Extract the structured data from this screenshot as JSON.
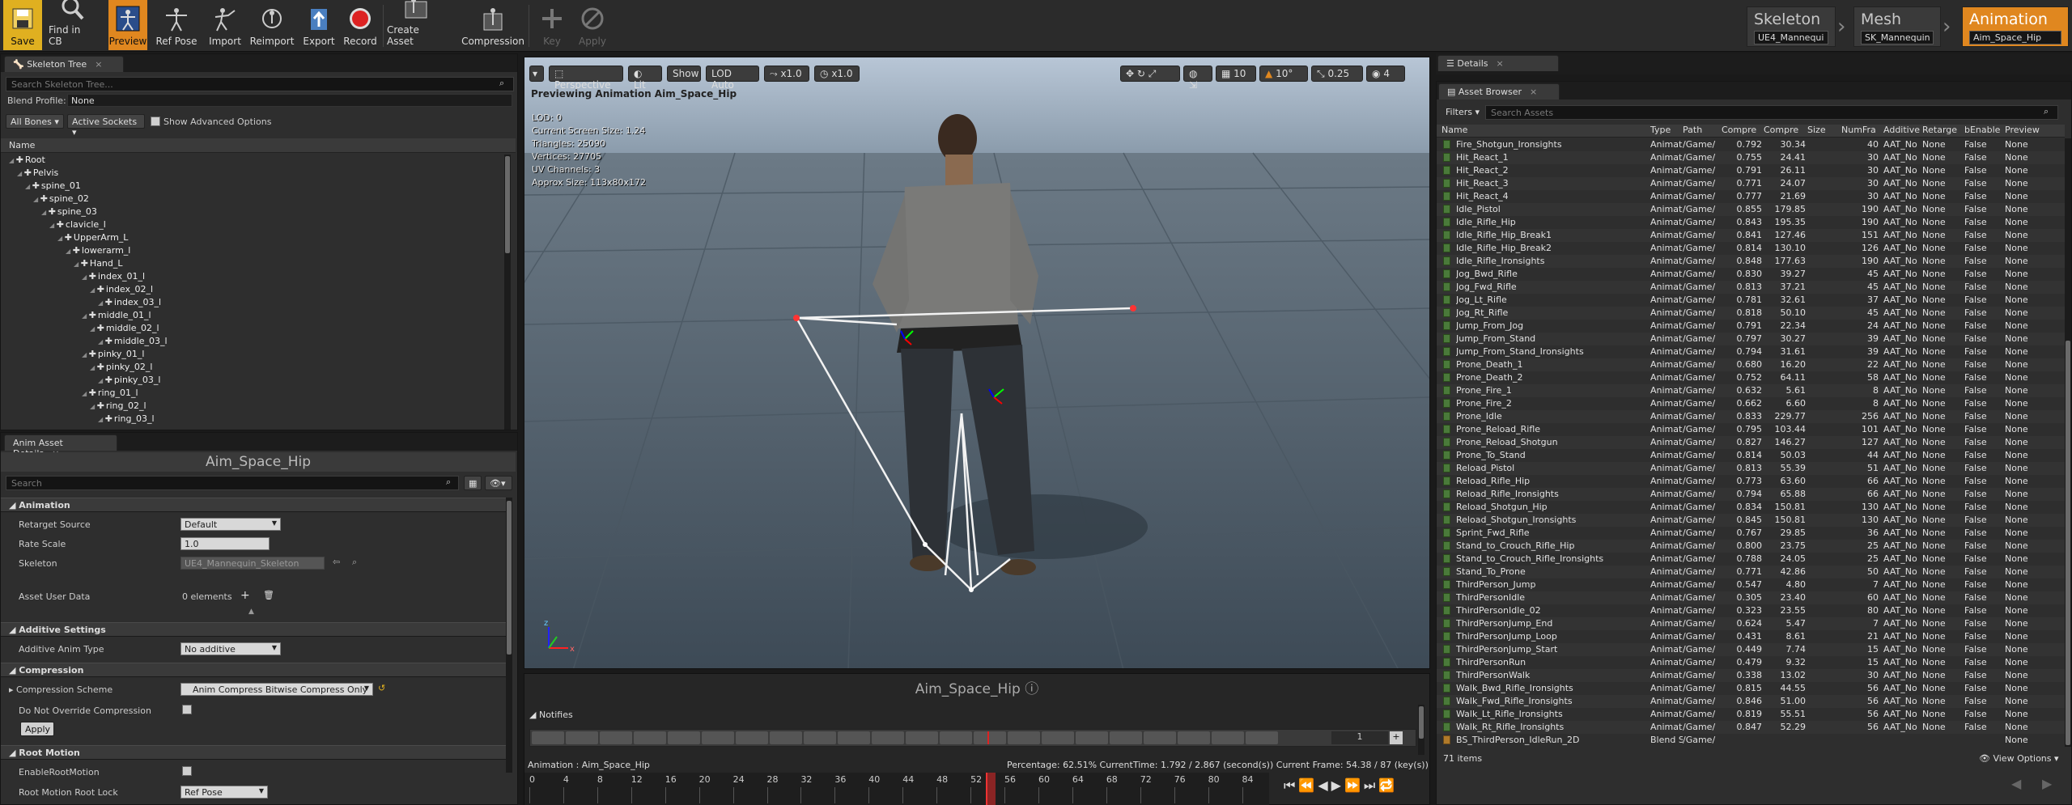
{
  "toolbar": {
    "buttons": [
      {
        "label": "Save",
        "icon": "save-icon"
      },
      {
        "label": "Find in CB",
        "icon": "find-in-cb-icon"
      },
      {
        "label": "Preview",
        "icon": "preview-icon"
      },
      {
        "label": "Ref Pose",
        "icon": "ref-pose-icon"
      },
      {
        "label": "Import",
        "icon": "import-icon"
      },
      {
        "label": "Reimport",
        "icon": "reimport-icon"
      },
      {
        "label": "Export",
        "icon": "export-icon"
      },
      {
        "label": "Record",
        "icon": "record-icon"
      },
      {
        "label": "Create Asset",
        "icon": "create-asset-icon"
      },
      {
        "label": "Compression",
        "icon": "compression-icon"
      },
      {
        "label": "Key",
        "icon": "key-icon"
      },
      {
        "label": "Apply",
        "icon": "apply-icon"
      }
    ]
  },
  "modes": {
    "skeleton": {
      "title": "Skeleton",
      "asset": "UE4_Mannequi"
    },
    "mesh": {
      "title": "Mesh",
      "asset": "SK_Mannequin"
    },
    "animation": {
      "title": "Animation",
      "asset": "Aim_Space_Hip"
    }
  },
  "skeleton_tree": {
    "tab": "Skeleton Tree",
    "search_placeholder": "Search Skeleton Tree...",
    "blend_profile_label": "Blend Profile:",
    "blend_profile_value": "None",
    "all_bones": "All Bones",
    "active_sockets": "Active Sockets",
    "show_advanced": "Show Advanced Options",
    "column": "Name",
    "bones": [
      {
        "name": "Root",
        "depth": 0
      },
      {
        "name": "Pelvis",
        "depth": 1
      },
      {
        "name": "spine_01",
        "depth": 2
      },
      {
        "name": "spine_02",
        "depth": 3
      },
      {
        "name": "spine_03",
        "depth": 4
      },
      {
        "name": "clavicle_l",
        "depth": 5
      },
      {
        "name": "UpperArm_L",
        "depth": 6
      },
      {
        "name": "lowerarm_l",
        "depth": 7
      },
      {
        "name": "Hand_L",
        "depth": 8
      },
      {
        "name": "index_01_l",
        "depth": 9
      },
      {
        "name": "index_02_l",
        "depth": 10
      },
      {
        "name": "index_03_l",
        "depth": 11
      },
      {
        "name": "middle_01_l",
        "depth": 9
      },
      {
        "name": "middle_02_l",
        "depth": 10
      },
      {
        "name": "middle_03_l",
        "depth": 11
      },
      {
        "name": "pinky_01_l",
        "depth": 9
      },
      {
        "name": "pinky_02_l",
        "depth": 10
      },
      {
        "name": "pinky_03_l",
        "depth": 11
      },
      {
        "name": "ring_01_l",
        "depth": 9
      },
      {
        "name": "ring_02_l",
        "depth": 10
      },
      {
        "name": "ring_03_l",
        "depth": 11
      }
    ]
  },
  "anim_details": {
    "tab": "Anim Asset Details",
    "title": "Aim_Space_Hip",
    "search_placeholder": "Search",
    "sections": {
      "animation": "Animation",
      "additive": "Additive Settings",
      "compression": "Compression",
      "root_motion": "Root Motion"
    },
    "retarget_source_label": "Retarget Source",
    "retarget_source_value": "Default",
    "rate_scale_label": "Rate Scale",
    "rate_scale_value": "1.0",
    "skeleton_label": "Skeleton",
    "skeleton_value": "UE4_Mannequin_Skeleton",
    "asset_user_data_label": "Asset User Data",
    "asset_user_data_value": "0 elements",
    "additive_type_label": "Additive Anim Type",
    "additive_type_value": "No additive",
    "compression_scheme_label": "Compression Scheme",
    "compression_scheme_value": "Anim Compress Bitwise Compress Only",
    "no_override_label": "Do Not Override Compression",
    "apply_label": "Apply",
    "enable_root_motion_label": "EnableRootMotion",
    "root_lock_label": "Root Motion Root Lock",
    "root_lock_value": "Ref Pose"
  },
  "viewport": {
    "perspective": "Perspective",
    "lit": "Lit",
    "show": "Show",
    "lod": "LOD Auto",
    "speed1": "x1.0",
    "speed2": "x1.0",
    "grid": "10",
    "rot": "10°",
    "scale": "0.25",
    "cam": "4",
    "preview_text": "Previewing Animation Aim_Space_Hip",
    "stats": [
      "LOD: 0",
      "Current Screen Size: 1.24",
      "Triangles: 25090",
      "Vertices: 27705",
      "UV Channels: 3",
      "Approx Size: 113x80x172"
    ]
  },
  "timeline": {
    "title": "Aim_Space_Hip",
    "notifies": "Notifies",
    "track_number": "1",
    "animation_label": "Animation :  Aim_Space_Hip",
    "status": "Percentage:  62.51%  CurrentTime:  1.792 / 2.867 (second(s))  Current Frame:  54.38 / 87 (key(s))",
    "ticks": [
      "0",
      "4",
      "8",
      "12",
      "16",
      "20",
      "24",
      "28",
      "32",
      "36",
      "40",
      "44",
      "48",
      "52",
      "56",
      "60",
      "64",
      "68",
      "72",
      "76",
      "80",
      "84"
    ],
    "playhead_frame": 54.38,
    "total_frames": 87
  },
  "details_tab": "Details",
  "asset_browser": {
    "tab": "Asset Browser",
    "filters": "Filters",
    "search_placeholder": "Search Assets",
    "columns": [
      "Name",
      "Type",
      "Path",
      "Compre",
      "Compre",
      "Size",
      "NumFra",
      "Additive",
      "Retarge",
      "bEnable",
      "Preview"
    ],
    "rows": [
      [
        "Fire_Shotgun_Ironsights",
        "Animat",
        "/Game/",
        "0.792",
        "30.34",
        "",
        "40",
        "AAT_No",
        "None",
        "False",
        "None"
      ],
      [
        "Hit_React_1",
        "Animat",
        "/Game/",
        "0.755",
        "24.41",
        "",
        "30",
        "AAT_No",
        "None",
        "False",
        "None"
      ],
      [
        "Hit_React_2",
        "Animat",
        "/Game/",
        "0.791",
        "26.11",
        "",
        "30",
        "AAT_No",
        "None",
        "False",
        "None"
      ],
      [
        "Hit_React_3",
        "Animat",
        "/Game/",
        "0.771",
        "24.07",
        "",
        "30",
        "AAT_No",
        "None",
        "False",
        "None"
      ],
      [
        "Hit_React_4",
        "Animat",
        "/Game/",
        "0.777",
        "21.69",
        "",
        "30",
        "AAT_No",
        "None",
        "False",
        "None"
      ],
      [
        "Idle_Pistol",
        "Animat",
        "/Game/",
        "0.855",
        "179.85",
        "",
        "190",
        "AAT_No",
        "None",
        "False",
        "None"
      ],
      [
        "Idle_Rifle_Hip",
        "Animat",
        "/Game/",
        "0.843",
        "195.35",
        "",
        "190",
        "AAT_No",
        "None",
        "False",
        "None"
      ],
      [
        "Idle_Rifle_Hip_Break1",
        "Animat",
        "/Game/",
        "0.841",
        "127.46",
        "",
        "151",
        "AAT_No",
        "None",
        "False",
        "None"
      ],
      [
        "Idle_Rifle_Hip_Break2",
        "Animat",
        "/Game/",
        "0.814",
        "130.10",
        "",
        "126",
        "AAT_No",
        "None",
        "False",
        "None"
      ],
      [
        "Idle_Rifle_Ironsights",
        "Animat",
        "/Game/",
        "0.848",
        "177.63",
        "",
        "190",
        "AAT_No",
        "None",
        "False",
        "None"
      ],
      [
        "Jog_Bwd_Rifle",
        "Animat",
        "/Game/",
        "0.830",
        "39.27",
        "",
        "45",
        "AAT_No",
        "None",
        "False",
        "None"
      ],
      [
        "Jog_Fwd_Rifle",
        "Animat",
        "/Game/",
        "0.813",
        "37.21",
        "",
        "45",
        "AAT_No",
        "None",
        "False",
        "None"
      ],
      [
        "Jog_Lt_Rifle",
        "Animat",
        "/Game/",
        "0.781",
        "32.61",
        "",
        "37",
        "AAT_No",
        "None",
        "False",
        "None"
      ],
      [
        "Jog_Rt_Rifle",
        "Animat",
        "/Game/",
        "0.818",
        "50.10",
        "",
        "45",
        "AAT_No",
        "None",
        "False",
        "None"
      ],
      [
        "Jump_From_Jog",
        "Animat",
        "/Game/",
        "0.791",
        "22.34",
        "",
        "24",
        "AAT_No",
        "None",
        "False",
        "None"
      ],
      [
        "Jump_From_Stand",
        "Animat",
        "/Game/",
        "0.797",
        "30.27",
        "",
        "39",
        "AAT_No",
        "None",
        "False",
        "None"
      ],
      [
        "Jump_From_Stand_Ironsights",
        "Animat",
        "/Game/",
        "0.794",
        "31.61",
        "",
        "39",
        "AAT_No",
        "None",
        "False",
        "None"
      ],
      [
        "Prone_Death_1",
        "Animat",
        "/Game/",
        "0.680",
        "16.20",
        "",
        "22",
        "AAT_No",
        "None",
        "False",
        "None"
      ],
      [
        "Prone_Death_2",
        "Animat",
        "/Game/",
        "0.752",
        "64.11",
        "",
        "58",
        "AAT_No",
        "None",
        "False",
        "None"
      ],
      [
        "Prone_Fire_1",
        "Animat",
        "/Game/",
        "0.632",
        "5.61",
        "",
        "8",
        "AAT_No",
        "None",
        "False",
        "None"
      ],
      [
        "Prone_Fire_2",
        "Animat",
        "/Game/",
        "0.662",
        "6.60",
        "",
        "8",
        "AAT_No",
        "None",
        "False",
        "None"
      ],
      [
        "Prone_Idle",
        "Animat",
        "/Game/",
        "0.833",
        "229.77",
        "",
        "256",
        "AAT_No",
        "None",
        "False",
        "None"
      ],
      [
        "Prone_Reload_Rifle",
        "Animat",
        "/Game/",
        "0.795",
        "103.44",
        "",
        "101",
        "AAT_No",
        "None",
        "False",
        "None"
      ],
      [
        "Prone_Reload_Shotgun",
        "Animat",
        "/Game/",
        "0.827",
        "146.27",
        "",
        "127",
        "AAT_No",
        "None",
        "False",
        "None"
      ],
      [
        "Prone_To_Stand",
        "Animat",
        "/Game/",
        "0.814",
        "50.03",
        "",
        "44",
        "AAT_No",
        "None",
        "False",
        "None"
      ],
      [
        "Reload_Pistol",
        "Animat",
        "/Game/",
        "0.813",
        "55.39",
        "",
        "51",
        "AAT_No",
        "None",
        "False",
        "None"
      ],
      [
        "Reload_Rifle_Hip",
        "Animat",
        "/Game/",
        "0.773",
        "63.60",
        "",
        "66",
        "AAT_No",
        "None",
        "False",
        "None"
      ],
      [
        "Reload_Rifle_Ironsights",
        "Animat",
        "/Game/",
        "0.794",
        "65.88",
        "",
        "66",
        "AAT_No",
        "None",
        "False",
        "None"
      ],
      [
        "Reload_Shotgun_Hip",
        "Animat",
        "/Game/",
        "0.834",
        "150.81",
        "",
        "130",
        "AAT_No",
        "None",
        "False",
        "None"
      ],
      [
        "Reload_Shotgun_Ironsights",
        "Animat",
        "/Game/",
        "0.845",
        "150.81",
        "",
        "130",
        "AAT_No",
        "None",
        "False",
        "None"
      ],
      [
        "Sprint_Fwd_Rifle",
        "Animat",
        "/Game/",
        "0.767",
        "29.85",
        "",
        "36",
        "AAT_No",
        "None",
        "False",
        "None"
      ],
      [
        "Stand_to_Crouch_Rifle_Hip",
        "Animat",
        "/Game/",
        "0.800",
        "23.75",
        "",
        "25",
        "AAT_No",
        "None",
        "False",
        "None"
      ],
      [
        "Stand_to_Crouch_Rifle_Ironsights",
        "Animat",
        "/Game/",
        "0.788",
        "24.05",
        "",
        "25",
        "AAT_No",
        "None",
        "False",
        "None"
      ],
      [
        "Stand_To_Prone",
        "Animat",
        "/Game/",
        "0.771",
        "42.86",
        "",
        "50",
        "AAT_No",
        "None",
        "False",
        "None"
      ],
      [
        "ThirdPerson_Jump",
        "Animat",
        "/Game/",
        "0.547",
        "4.80",
        "",
        "7",
        "AAT_No",
        "None",
        "False",
        "None"
      ],
      [
        "ThirdPersonIdle",
        "Animat",
        "/Game/",
        "0.305",
        "23.40",
        "",
        "60",
        "AAT_No",
        "None",
        "False",
        "None"
      ],
      [
        "ThirdPersonIdle_02",
        "Animat",
        "/Game/",
        "0.323",
        "23.55",
        "",
        "80",
        "AAT_No",
        "None",
        "False",
        "None"
      ],
      [
        "ThirdPersonJump_End",
        "Animat",
        "/Game/",
        "0.624",
        "5.47",
        "",
        "7",
        "AAT_No",
        "None",
        "False",
        "None"
      ],
      [
        "ThirdPersonJump_Loop",
        "Animat",
        "/Game/",
        "0.431",
        "8.61",
        "",
        "21",
        "AAT_No",
        "None",
        "False",
        "None"
      ],
      [
        "ThirdPersonJump_Start",
        "Animat",
        "/Game/",
        "0.449",
        "7.74",
        "",
        "15",
        "AAT_No",
        "None",
        "False",
        "None"
      ],
      [
        "ThirdPersonRun",
        "Animat",
        "/Game/",
        "0.479",
        "9.32",
        "",
        "15",
        "AAT_No",
        "None",
        "False",
        "None"
      ],
      [
        "ThirdPersonWalk",
        "Animat",
        "/Game/",
        "0.338",
        "13.02",
        "",
        "30",
        "AAT_No",
        "None",
        "False",
        "None"
      ],
      [
        "Walk_Bwd_Rifle_Ironsights",
        "Animat",
        "/Game/",
        "0.815",
        "44.55",
        "",
        "56",
        "AAT_No",
        "None",
        "False",
        "None"
      ],
      [
        "Walk_Fwd_Rifle_Ironsights",
        "Animat",
        "/Game/",
        "0.846",
        "51.00",
        "",
        "56",
        "AAT_No",
        "None",
        "False",
        "None"
      ],
      [
        "Walk_Lt_Rifle_Ironsights",
        "Animat",
        "/Game/",
        "0.819",
        "55.51",
        "",
        "56",
        "AAT_No",
        "None",
        "False",
        "None"
      ],
      [
        "Walk_Rt_Rifle_Ironsights",
        "Animat",
        "/Game/",
        "0.847",
        "52.29",
        "",
        "56",
        "AAT_No",
        "None",
        "False",
        "None"
      ],
      [
        "BS_ThirdPerson_IdleRun_2D",
        "Blend S",
        "/Game/",
        "",
        "",
        "",
        "",
        "",
        "",
        "",
        "None"
      ]
    ],
    "count": "71 items",
    "view_options": "View Options"
  }
}
